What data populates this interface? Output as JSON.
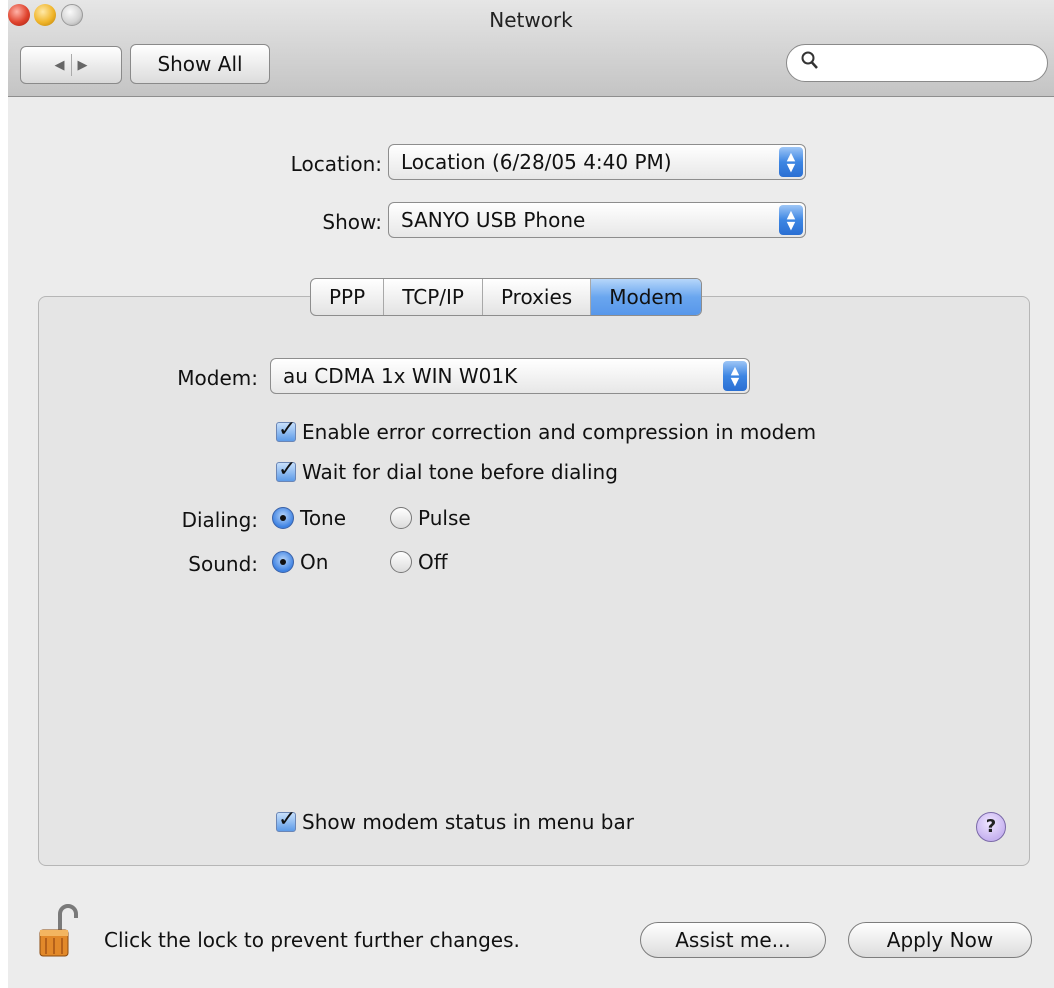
{
  "window": {
    "title": "Network"
  },
  "toolbar": {
    "back_glyph": "◀",
    "forward_glyph": "▶",
    "show_all_label": "Show All",
    "search_placeholder": "",
    "search_icon": "search-icon"
  },
  "location": {
    "label": "Location:",
    "value": "Location (6/28/05 4:40 PM)"
  },
  "show": {
    "label": "Show:",
    "value": "SANYO USB Phone"
  },
  "tabs": [
    {
      "label": "PPP",
      "active": false
    },
    {
      "label": "TCP/IP",
      "active": false
    },
    {
      "label": "Proxies",
      "active": false
    },
    {
      "label": "Modem",
      "active": true
    }
  ],
  "modem": {
    "label": "Modem:",
    "value": "au CDMA 1x WIN W01K",
    "error_correction_label": "Enable error correction and compression in modem",
    "error_correction_checked": true,
    "wait_dial_tone_label": "Wait for dial tone before dialing",
    "wait_dial_tone_checked": true,
    "dialing": {
      "label": "Dialing:",
      "options": [
        "Tone",
        "Pulse"
      ],
      "selected": "Tone"
    },
    "sound": {
      "label": "Sound:",
      "options": [
        "On",
        "Off"
      ],
      "selected": "On"
    },
    "status_menu_label": "Show modem status in menu bar",
    "status_menu_checked": true,
    "help_label": "?"
  },
  "footer": {
    "lock_text": "Click the lock to prevent further changes.",
    "assist_label": "Assist me...",
    "apply_label": "Apply Now"
  },
  "colors": {
    "accent": "#5797ea",
    "window_bg": "#ececec"
  }
}
